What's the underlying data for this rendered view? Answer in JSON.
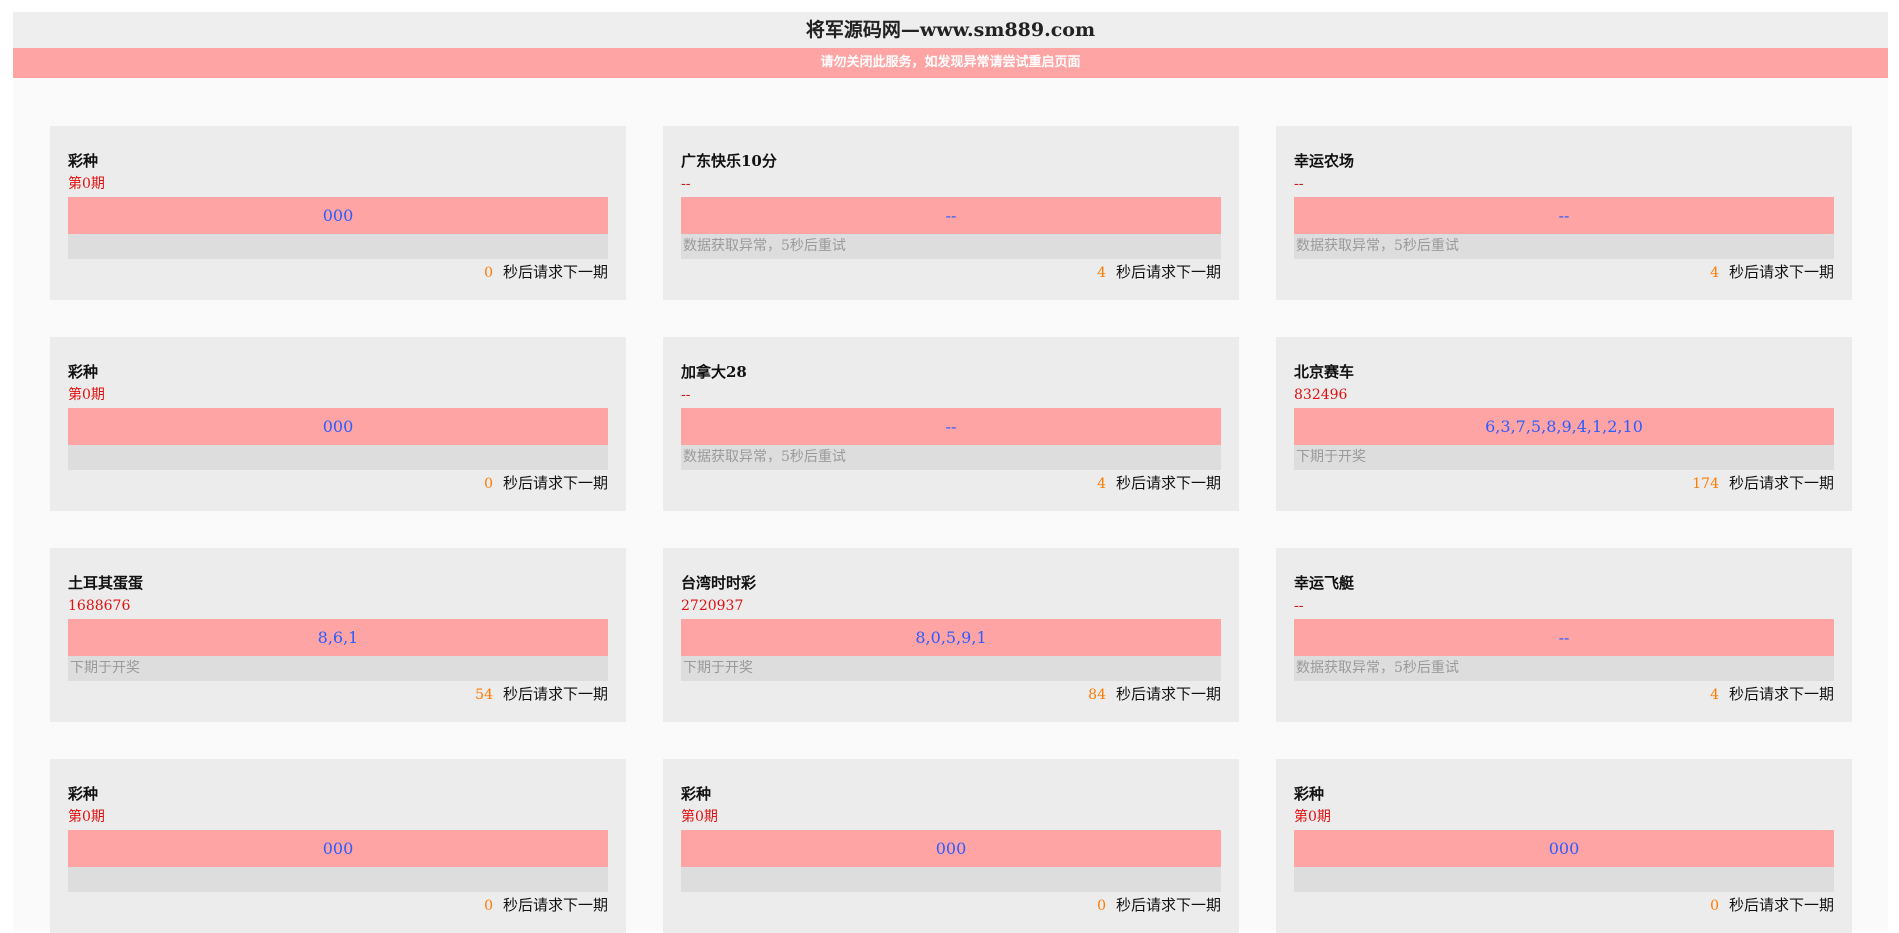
{
  "header": {
    "title": "将军源码网—www.sm889.com",
    "notice": "请勿关闭此服务，如发现异常请尝试重启页面"
  },
  "colors": {
    "result_bar": "#ffa4a4",
    "result_text": "#2b5cff",
    "issue_text": "#e01010",
    "countdown": "#ff7a00"
  },
  "countdown_suffix": "秒后请求下一期",
  "cards": [
    {
      "name": "彩种",
      "issue": "第0期",
      "result": "000",
      "status": "",
      "countdown": "0"
    },
    {
      "name": "广东快乐10分",
      "issue": "--",
      "result": "--",
      "status": "数据获取异常，5秒后重试",
      "countdown": "4"
    },
    {
      "name": "幸运农场",
      "issue": "--",
      "result": "--",
      "status": "数据获取异常，5秒后重试",
      "countdown": "4"
    },
    {
      "name": "彩种",
      "issue": "第0期",
      "result": "000",
      "status": "",
      "countdown": "0"
    },
    {
      "name": "加拿大28",
      "issue": "--",
      "result": "--",
      "status": "数据获取异常，5秒后重试",
      "countdown": "4"
    },
    {
      "name": "北京赛车",
      "issue": "832496",
      "result": "6,3,7,5,8,9,4,1,2,10",
      "status": "下期于开奖",
      "countdown": "174"
    },
    {
      "name": "土耳其蛋蛋",
      "issue": "1688676",
      "result": "8,6,1",
      "status": "下期于开奖",
      "countdown": "54"
    },
    {
      "name": "台湾时时彩",
      "issue": "2720937",
      "result": "8,0,5,9,1",
      "status": "下期于开奖",
      "countdown": "84"
    },
    {
      "name": "幸运飞艇",
      "issue": "--",
      "result": "--",
      "status": "数据获取异常，5秒后重试",
      "countdown": "4"
    },
    {
      "name": "彩种",
      "issue": "第0期",
      "result": "000",
      "status": "",
      "countdown": "0"
    },
    {
      "name": "彩种",
      "issue": "第0期",
      "result": "000",
      "status": "",
      "countdown": "0"
    },
    {
      "name": "彩种",
      "issue": "第0期",
      "result": "000",
      "status": "",
      "countdown": "0"
    }
  ]
}
